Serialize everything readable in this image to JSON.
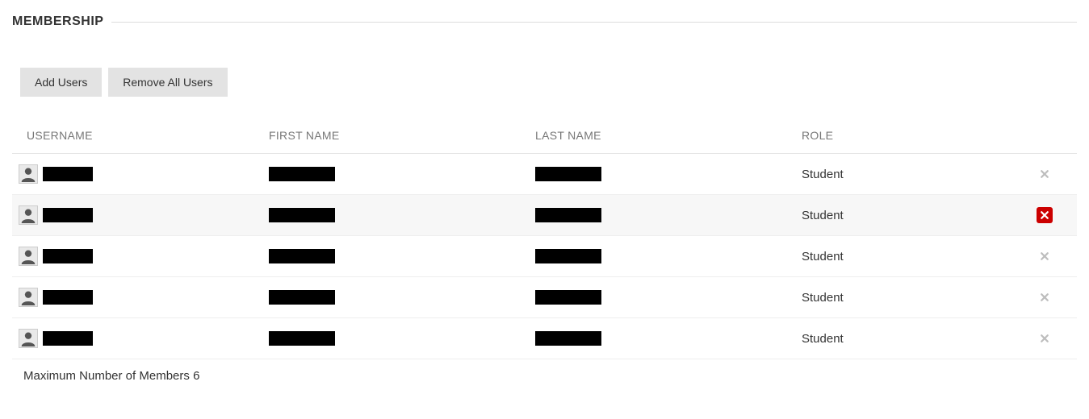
{
  "section": {
    "title": "MEMBERSHIP"
  },
  "buttons": {
    "add": "Add Users",
    "remove_all": "Remove All Users"
  },
  "columns": {
    "username": "USERNAME",
    "first": "FIRST NAME",
    "last": "LAST NAME",
    "role": "ROLE"
  },
  "rows": [
    {
      "username": "",
      "first": "",
      "last": "",
      "role": "Student",
      "highlight": false,
      "remove_active": false
    },
    {
      "username": "",
      "first": "",
      "last": "",
      "role": "Student",
      "highlight": true,
      "remove_active": true
    },
    {
      "username": "",
      "first": "",
      "last": "",
      "role": "Student",
      "highlight": false,
      "remove_active": false
    },
    {
      "username": "",
      "first": "",
      "last": "",
      "role": "Student",
      "highlight": false,
      "remove_active": false
    },
    {
      "username": "",
      "first": "",
      "last": "",
      "role": "Student",
      "highlight": false,
      "remove_active": false
    }
  ],
  "footer": {
    "max_members_label": "Maximum Number of Members",
    "max_members_value": "6"
  }
}
